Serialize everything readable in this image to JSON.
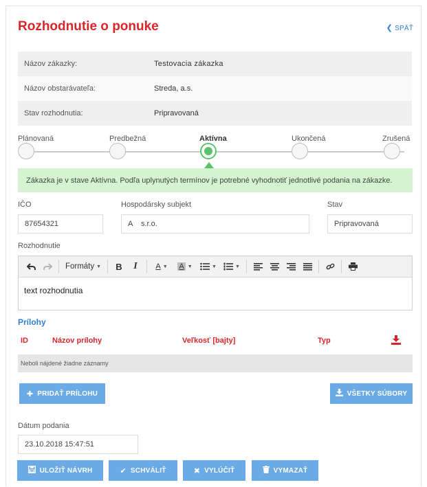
{
  "header": {
    "title": "Rozhodnutie o ponuke",
    "back_label": "SPÄŤ"
  },
  "info": [
    {
      "label": "Názov zákazky:",
      "value": "Testovacia  zákazka"
    },
    {
      "label": "Názov obstarávateľa:",
      "value": "Streda, a.s."
    },
    {
      "label": "Stav rozhodnutia:",
      "value": "Pripravovaná"
    }
  ],
  "steps": [
    {
      "label": "Plánovaná",
      "active": false
    },
    {
      "label": "Predbežná",
      "active": false
    },
    {
      "label": "Aktívna",
      "active": true
    },
    {
      "label": "Ukončená",
      "active": false
    },
    {
      "label": "Zrušená",
      "active": false
    }
  ],
  "alert": "Zákazka je v stave Aktívna. Podľa uplynutých termínov je potrebné vyhodnotiť jednotlivé podania na zákazke.",
  "form": {
    "ico_label": "IČO",
    "ico_value": "87654321",
    "subject_label": "Hospodársky subjekt",
    "subject_value": "A    s.r.o.",
    "stav_label": "Stav",
    "stav_value": "Pripravovaná",
    "decision_label": "Rozhodnutie",
    "decision_text": "text rozhodnutia",
    "date_label": "Dátum podania",
    "date_value": "23.10.2018 15:47:51"
  },
  "toolbar": {
    "formats_label": "Formáty"
  },
  "attachments": {
    "title": "Prílohy",
    "columns": [
      "ID",
      "Názov prílohy",
      "Veľkosť [bajty]",
      "Typ"
    ],
    "empty_text": "Neboli nájdené žiadne záznamy",
    "add_label": "PRIDAŤ PRÍLOHU",
    "all_files_label": "VŠETKY SÚBORY"
  },
  "actions": {
    "save_label": "ULOŽIŤ NÁVRH",
    "approve_label": "SCHVÁLIŤ",
    "exclude_label": "VYLÚČIŤ",
    "delete_label": "VYMAZAŤ"
  },
  "colors": {
    "title": "#d9262b",
    "link": "#2e7fd4",
    "active_step": "#5cc36d",
    "alert_bg": "#d5f3d1",
    "button": "#6aaae6"
  }
}
